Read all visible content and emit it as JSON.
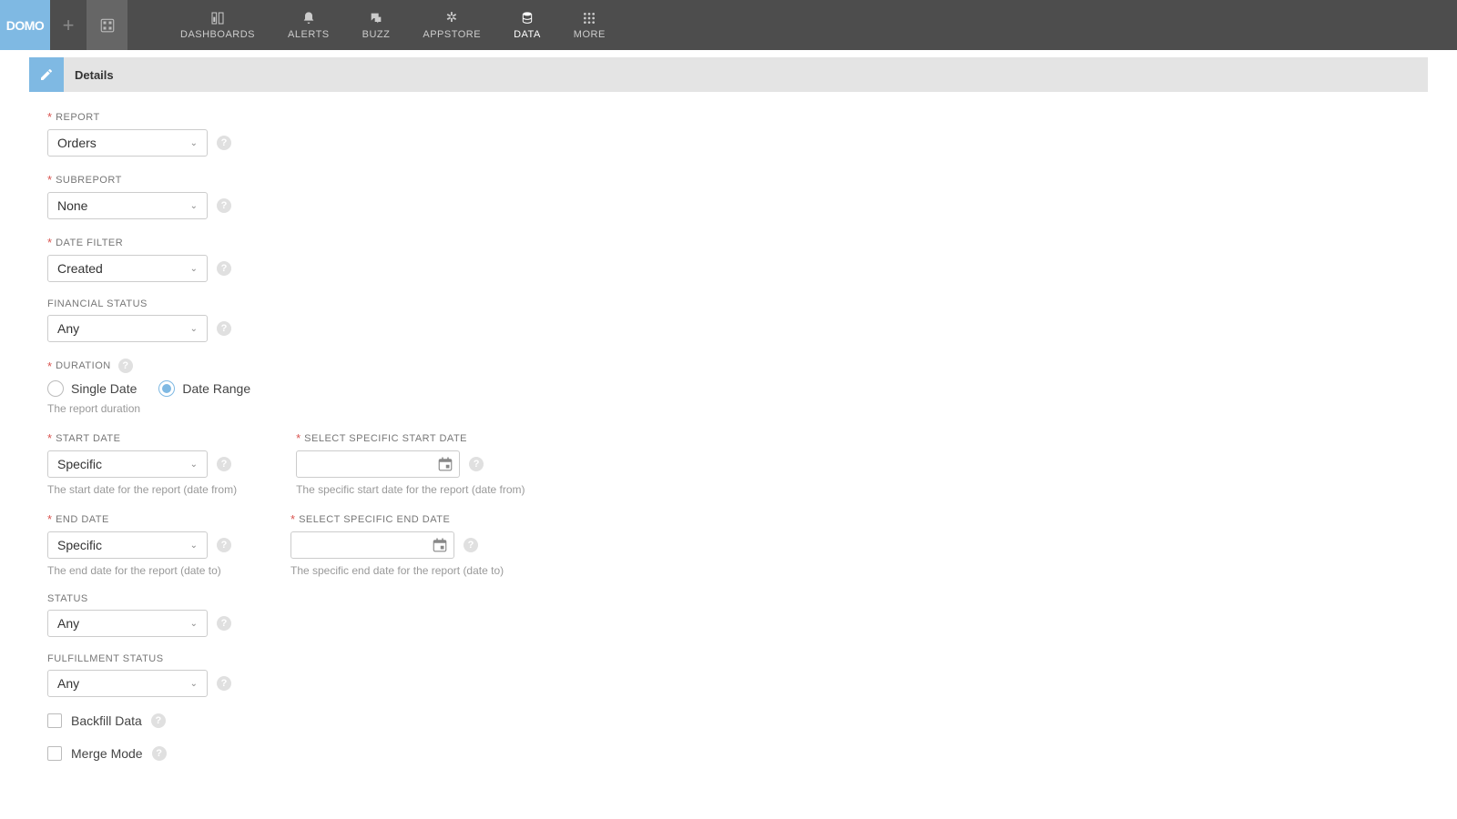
{
  "brand": "DOMO",
  "nav": {
    "dashboards": "DASHBOARDS",
    "alerts": "ALERTS",
    "buzz": "BUZZ",
    "appstore": "APPSTORE",
    "data": "DATA",
    "more": "MORE"
  },
  "header": {
    "title": "Details"
  },
  "form": {
    "report": {
      "label": "REPORT",
      "value": "Orders"
    },
    "subreport": {
      "label": "SUBREPORT",
      "value": "None"
    },
    "date_filter": {
      "label": "DATE FILTER",
      "value": "Created"
    },
    "financial_status": {
      "label": "FINANCIAL STATUS",
      "value": "Any"
    },
    "duration": {
      "label": "DURATION",
      "option_single": "Single Date",
      "option_range": "Date Range",
      "hint": "The report duration"
    },
    "start_date": {
      "label": "START DATE",
      "value": "Specific",
      "hint": "The start date for the report (date from)"
    },
    "specific_start": {
      "label": "SELECT SPECIFIC START DATE",
      "hint": "The specific start date for the report (date from)"
    },
    "end_date": {
      "label": "END DATE",
      "value": "Specific",
      "hint": "The end date for the report (date to)"
    },
    "specific_end": {
      "label": "SELECT SPECIFIC END DATE",
      "hint": "The specific end date for the report (date to)"
    },
    "status": {
      "label": "STATUS",
      "value": "Any"
    },
    "fulfillment_status": {
      "label": "FULFILLMENT STATUS",
      "value": "Any"
    },
    "backfill": {
      "label": "Backfill Data"
    },
    "merge": {
      "label": "Merge Mode"
    }
  }
}
